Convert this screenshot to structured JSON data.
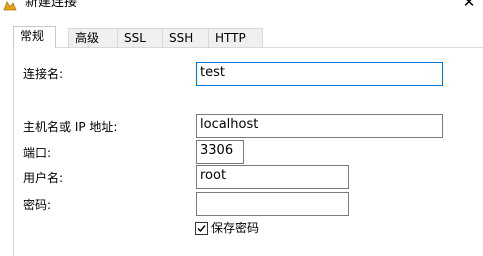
{
  "window": {
    "title": "新建连接",
    "close_label": "✕",
    "icon": "connection-icon"
  },
  "tabs": [
    {
      "label": "常规",
      "active": true
    },
    {
      "label": "高级",
      "active": false
    },
    {
      "label": "SSL",
      "active": false
    },
    {
      "label": "SSH",
      "active": false
    },
    {
      "label": "HTTP",
      "active": false
    }
  ],
  "form": {
    "connection_name_label": "连接名:",
    "connection_name_value": "test",
    "host_label": "主机名或 IP 地址:",
    "host_value": "localhost",
    "port_label": "端口:",
    "port_value": "3306",
    "username_label": "用户名:",
    "username_value": "root",
    "password_label": "密码:",
    "password_value": "",
    "save_password_label": "保存密码",
    "save_password_checked": true
  },
  "colors": {
    "focus_border": "#0078d7",
    "field_border": "#7a7a7a",
    "tab_border": "#d9d9d9"
  }
}
